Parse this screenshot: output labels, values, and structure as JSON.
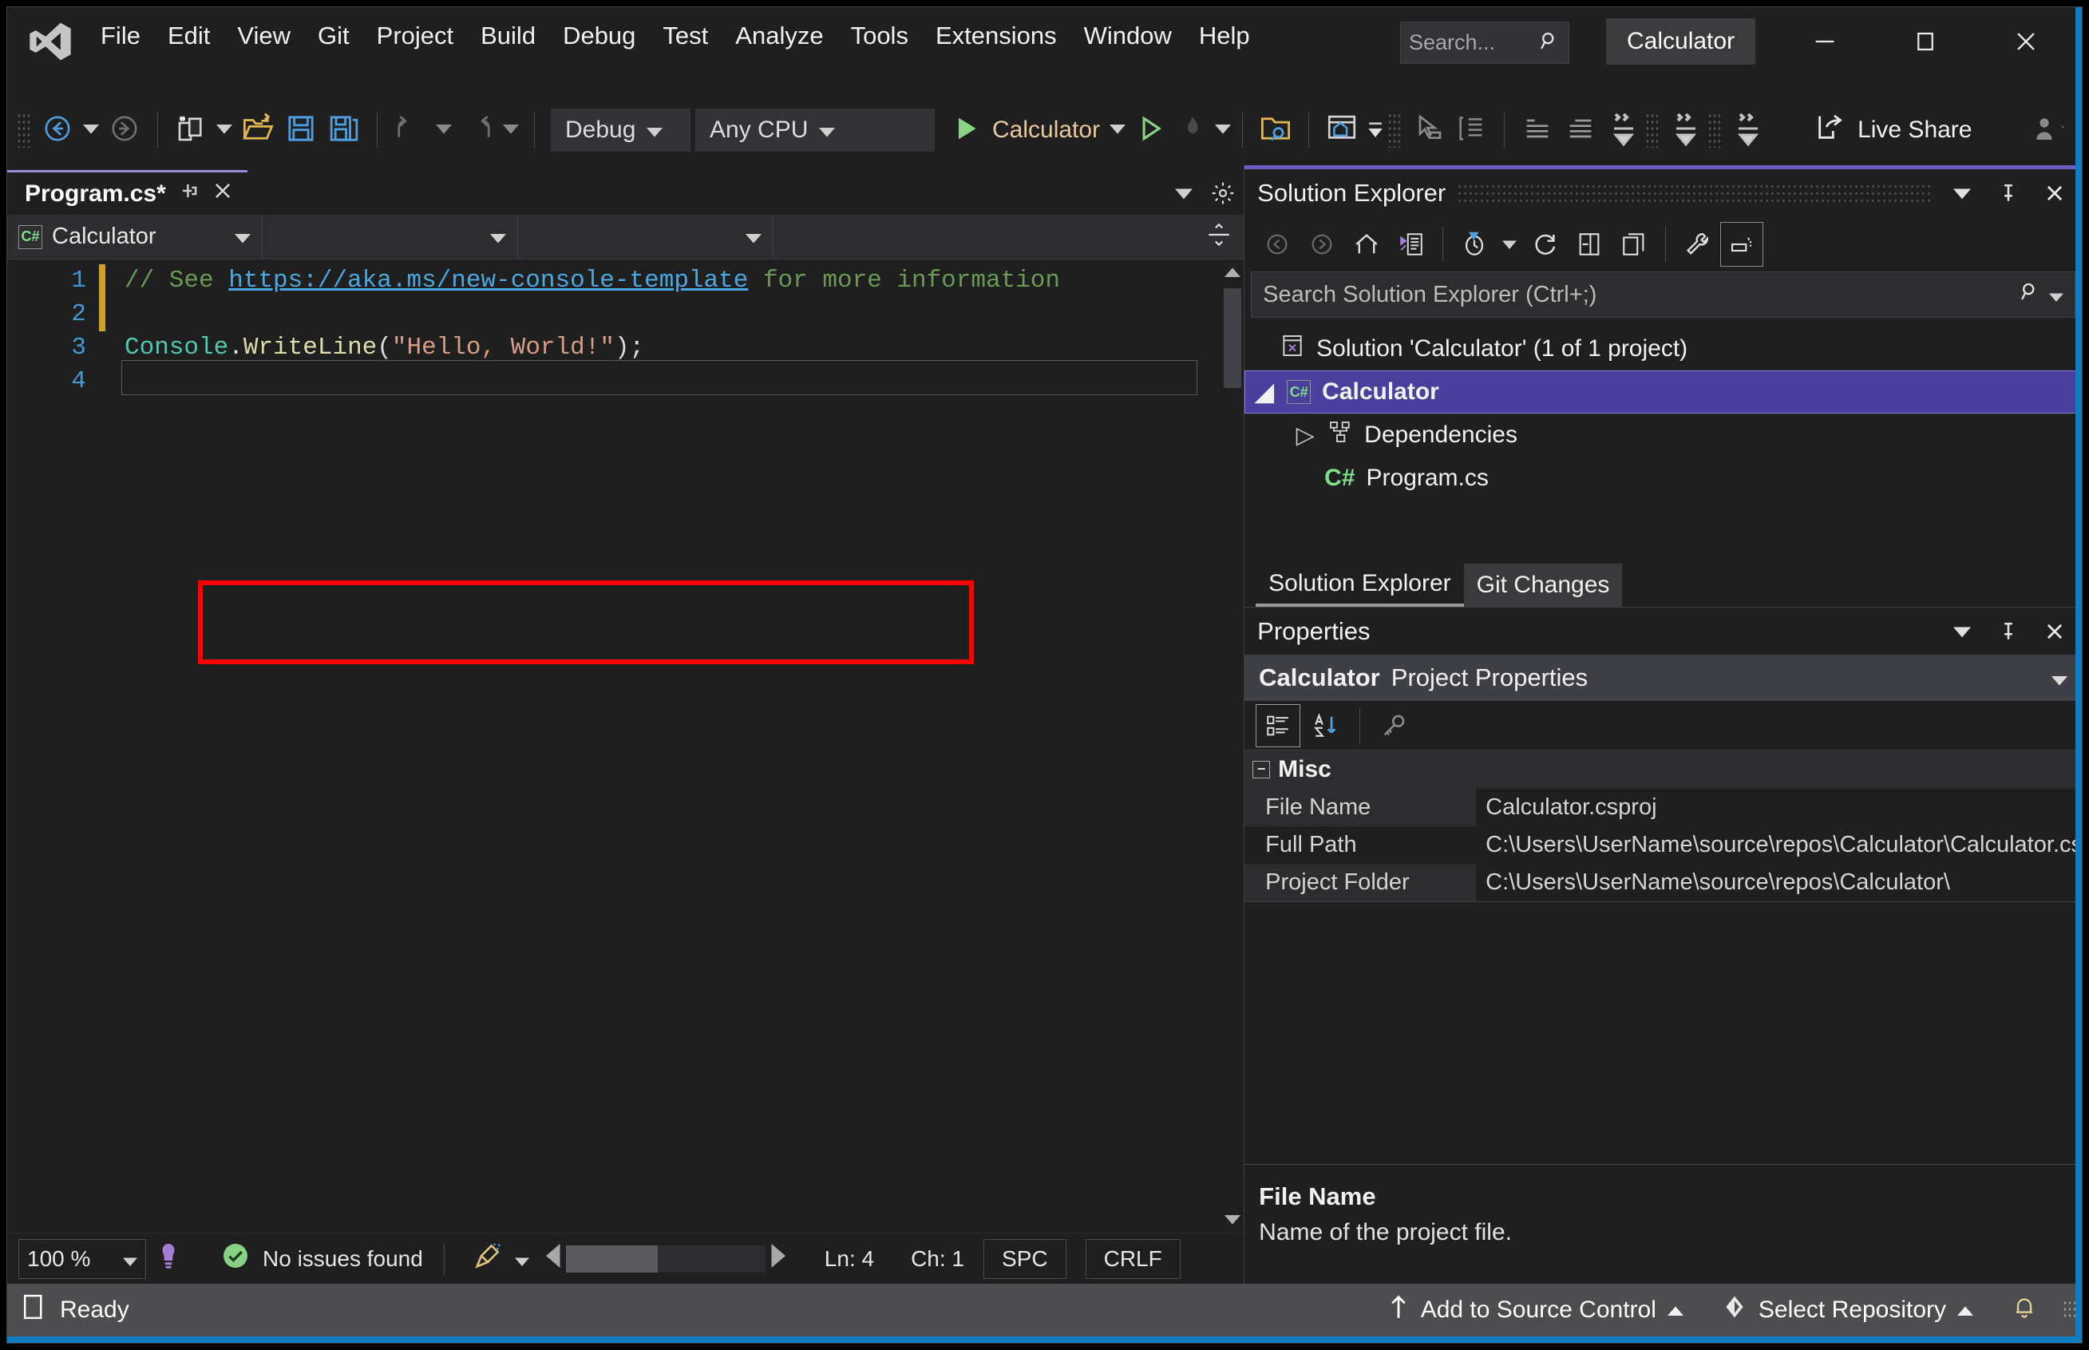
{
  "titlebar": {
    "logo": "visual-studio-logo",
    "menus": [
      "File",
      "Edit",
      "View",
      "Git",
      "Project",
      "Build",
      "Debug",
      "Test",
      "Analyze",
      "Tools",
      "Extensions",
      "Window",
      "Help"
    ],
    "search_placeholder": "Search...",
    "account_label": "Calculator",
    "window_buttons": {
      "minimize": "minimize-icon",
      "maximize": "maximize-icon",
      "close": "close-icon"
    }
  },
  "toolbar": {
    "back_label": "navigate-backward",
    "forward_label": "navigate-forward",
    "new_project_label": "new-project",
    "open_file_label": "open-file",
    "save_label": "save",
    "save_all_label": "save-all",
    "undo_label": "undo",
    "redo_label": "redo",
    "configuration": "Debug",
    "platform": "Any CPU",
    "start_target": "Calculator",
    "hot_reload_label": "hot-reload",
    "live_share_label": "Live Share"
  },
  "editor": {
    "tab_title": "Program.cs*",
    "pin_label": "pin-tab",
    "close_label": "close-tab",
    "nav_project": "Calculator",
    "nav_type": "",
    "nav_member": "",
    "lines": [
      "1",
      "2",
      "3",
      "4"
    ],
    "code": {
      "line1_comment_pre": "// See ",
      "line1_link": "https://aka.ms/new-console-template",
      "line1_comment_post": " for more information",
      "line3_class": "Console",
      "line3_dot": ".",
      "line3_method": "WriteLine",
      "line3_open": "(",
      "line3_string": "\"Hello, World!\"",
      "line3_close": ");"
    },
    "status": {
      "zoom": "100 %",
      "issues": "No issues found",
      "line": "Ln: 4",
      "char": "Ch: 1",
      "indent": "SPC",
      "eol": "CRLF"
    }
  },
  "solution_explorer": {
    "title": "Solution Explorer",
    "search_placeholder": "Search Solution Explorer (Ctrl+;)",
    "toolbar_icons": [
      "back-icon",
      "forward-icon",
      "home-icon",
      "pending-changes-icon",
      "history-icon",
      "refresh-icon",
      "collapse-all-icon",
      "show-all-files-icon",
      "properties-icon",
      "preview-selected-items-icon"
    ],
    "tree": [
      {
        "label": "Solution 'Calculator' (1 of 1 project)",
        "icon": "solution-icon",
        "depth": 0,
        "selected": false,
        "expander": ""
      },
      {
        "label": "Calculator",
        "icon": "csharp-project-icon",
        "depth": 1,
        "selected": true,
        "expander": "◢"
      },
      {
        "label": "Dependencies",
        "icon": "dependencies-icon",
        "depth": 2,
        "selected": false,
        "expander": "▷"
      },
      {
        "label": "Program.cs",
        "icon": "csharp-file-icon",
        "depth": 3,
        "selected": false,
        "expander": ""
      }
    ],
    "tabs": [
      {
        "label": "Solution Explorer",
        "active": true
      },
      {
        "label": "Git Changes",
        "active": false
      }
    ]
  },
  "properties": {
    "title": "Properties",
    "subject_name": "Calculator",
    "subject_kind": "Project Properties",
    "toolbar_icons": [
      "categorized-icon",
      "alphabetical-icon",
      "property-pages-icon"
    ],
    "category": "Misc",
    "rows": [
      {
        "key": "File Name",
        "value": "Calculator.csproj"
      },
      {
        "key": "Full Path",
        "value": "C:\\Users\\UserName\\source\\repos\\Calculator\\Calculator.csproj"
      },
      {
        "key": "Project Folder",
        "value": "C:\\Users\\UserName\\source\\repos\\Calculator\\"
      }
    ],
    "description_title": "File Name",
    "description_body": "Name of the project file."
  },
  "statusbar": {
    "ready": "Ready",
    "add_to_source_control": "Add to Source Control",
    "select_repository": "Select Repository",
    "notifications": "notifications-icon"
  },
  "colors": {
    "accent_purple": "#6d5fc4",
    "accent_blue": "#0e7dc1",
    "highlight_red": "#ff0000",
    "selection": "#4b3f9e",
    "statusbar": "#4d4d50"
  }
}
